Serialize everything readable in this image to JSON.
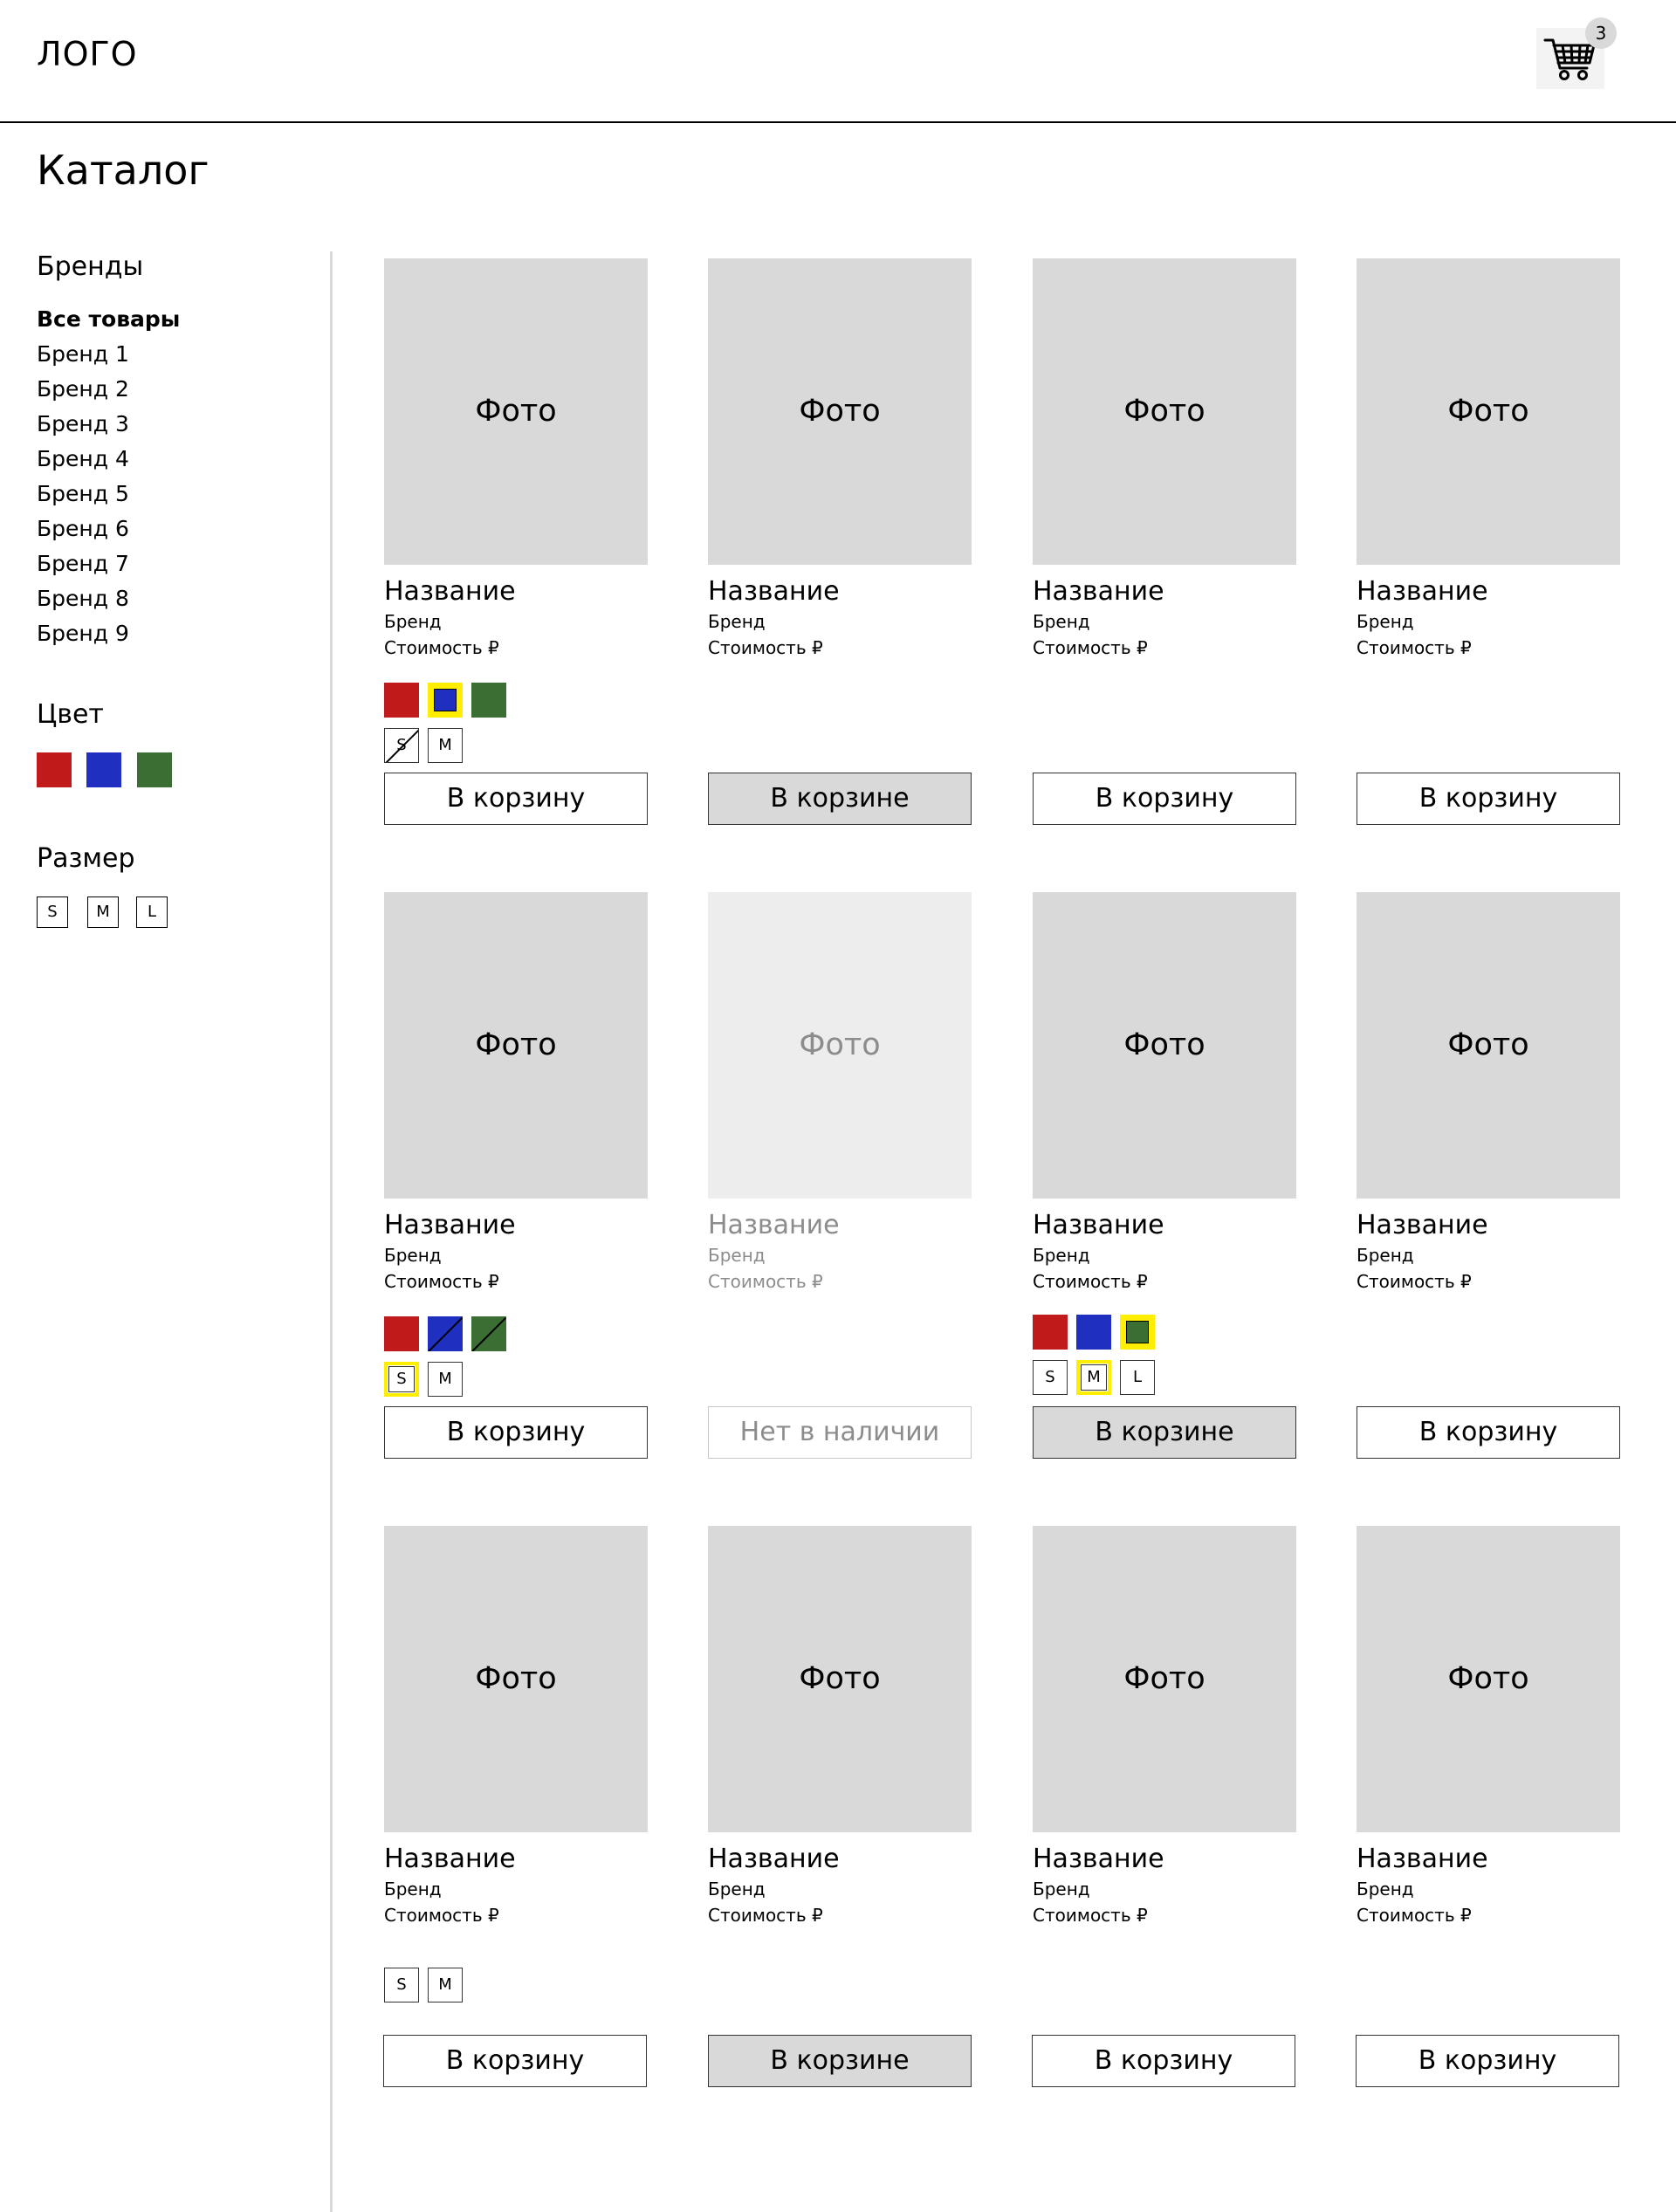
{
  "header": {
    "logo": "ЛОГО",
    "cart_count": "3"
  },
  "page_title": "Каталог",
  "sidebar": {
    "brands_title": "Бренды",
    "brands": [
      "Все товары",
      "Бренд 1",
      "Бренд 2",
      "Бренд 3",
      "Бренд 4",
      "Бренд 5",
      "Бренд 6",
      "Бренд 7",
      "Бренд 8",
      "Бренд 9"
    ],
    "active_brand": "Все товары",
    "color_title": "Цвет",
    "colors": [
      "#c01a1a",
      "#1f2fc0",
      "#3a6e33"
    ],
    "size_title": "Размер",
    "sizes": [
      "S",
      "M",
      "L"
    ]
  },
  "products": [
    {
      "photo": "Фото",
      "name": "Название",
      "brand": "Бренд",
      "price": "Стоимость ₽",
      "button": "В корзину",
      "state": "normal",
      "colors": [
        {
          "hex": "#c01a1a"
        },
        {
          "hex": "#1f2fc0",
          "selected": true
        },
        {
          "hex": "#3a6e33"
        }
      ],
      "sizes": [
        {
          "label": "S",
          "unavailable": true
        },
        {
          "label": "M"
        }
      ]
    },
    {
      "photo": "Фото",
      "name": "Название",
      "brand": "Бренд",
      "price": "Стоимость ₽",
      "button": "В корзине",
      "state": "in-cart"
    },
    {
      "photo": "Фото",
      "name": "Название",
      "brand": "Бренд",
      "price": "Стоимость ₽",
      "button": "В корзину",
      "state": "normal"
    },
    {
      "photo": "Фото",
      "name": "Название",
      "brand": "Бренд",
      "price": "Стоимость ₽",
      "button": "В корзину",
      "state": "normal"
    },
    {
      "photo": "Фото",
      "name": "Название",
      "brand": "Бренд",
      "price": "Стоимость ₽",
      "button": "В корзину",
      "state": "normal",
      "colors": [
        {
          "hex": "#c01a1a"
        },
        {
          "hex": "#1f2fc0",
          "unavailable": true
        },
        {
          "hex": "#3a6e33",
          "unavailable": true
        }
      ],
      "sizes": [
        {
          "label": "S",
          "selected": true
        },
        {
          "label": "M"
        }
      ]
    },
    {
      "photo": "Фото",
      "name": "Название",
      "brand": "Бренд",
      "price": "Стоимость ₽",
      "button": "Нет в наличии",
      "state": "out-of-stock"
    },
    {
      "photo": "Фото",
      "name": "Название",
      "brand": "Бренд",
      "price": "Стоимость ₽",
      "button": "В корзине",
      "state": "in-cart",
      "colors": [
        {
          "hex": "#c01a1a"
        },
        {
          "hex": "#1f2fc0"
        },
        {
          "hex": "#3a6e33",
          "selected": true
        }
      ],
      "sizes": [
        {
          "label": "S"
        },
        {
          "label": "M",
          "selected": true
        },
        {
          "label": "L"
        }
      ]
    },
    {
      "photo": "Фото",
      "name": "Название",
      "brand": "Бренд",
      "price": "Стоимость ₽",
      "button": "В корзину",
      "state": "normal"
    },
    {
      "photo": "Фото",
      "name": "Название",
      "brand": "Бренд",
      "price": "Стоимость ₽",
      "button": "В корзину",
      "state": "normal",
      "sizes": [
        {
          "label": "S"
        },
        {
          "label": "M"
        }
      ]
    },
    {
      "photo": "Фото",
      "name": "Название",
      "brand": "Бренд",
      "price": "Стоимость ₽",
      "button": "В корзине",
      "state": "in-cart"
    },
    {
      "photo": "Фото",
      "name": "Название",
      "brand": "Бренд",
      "price": "Стоимость ₽",
      "button": "В корзину",
      "state": "normal"
    },
    {
      "photo": "Фото",
      "name": "Название",
      "brand": "Бренд",
      "price": "Стоимость ₽",
      "button": "В корзину",
      "state": "normal"
    }
  ]
}
